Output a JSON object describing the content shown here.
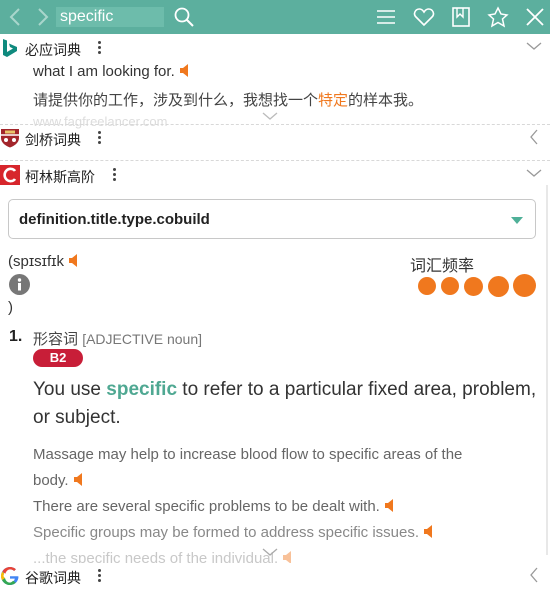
{
  "toolbar": {
    "search_value": "specific",
    "icons": [
      "back-arrow-icon",
      "forward-arrow-icon",
      "search-icon",
      "menu-icon",
      "heart-icon",
      "bookmark-icon",
      "pin-icon",
      "close-icon"
    ],
    "color": "#5caf9e"
  },
  "bing": {
    "name": "必应词典",
    "line1": "what I am looking for.",
    "line2_pre": "请提供你的工作，涉及到什么，我想找一个",
    "line2_hl": "特定",
    "line2_post": "的样本我。",
    "source": "www.fagfreelancer.com"
  },
  "cambridge": {
    "name": "剑桥词典"
  },
  "collins": {
    "name": "柯林斯高阶",
    "select_value": "definition.title.type.cobuild",
    "pron": "(spɪsɪfɪk",
    "pron_close": ")",
    "freq_label": "词汇频率",
    "freq_level": 5,
    "sense_num": "1.",
    "pos": "形容词",
    "pos_en": "[ADJECTIVE noun]",
    "level": "B2",
    "def_pre": "You use ",
    "def_hl": "specific",
    "def_post": " to refer to a particular fixed area, problem,",
    "def_line2": "or subject.",
    "ex1a": "Massage may help to increase blood flow to specific areas of the",
    "ex1b": "body.",
    "ex2": "There are several specific problems to be dealt with.",
    "ex3": "Specific groups may be formed to address specific issues.",
    "ex4": "...the specific needs of the individual."
  },
  "google": {
    "name": "谷歌词典"
  },
  "colors": {
    "accent": "#5caf9e",
    "orange": "#f0781e",
    "badge": "#c81e38"
  }
}
